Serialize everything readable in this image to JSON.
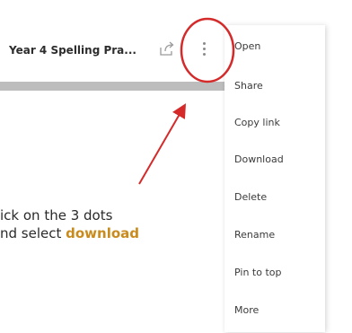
{
  "file": {
    "name": "Year 4 Spelling Pra..."
  },
  "icons": {
    "share": "share-icon",
    "more": "more-dots-icon"
  },
  "menu": {
    "items": [
      {
        "label": "Open"
      },
      {
        "label": "Share"
      },
      {
        "label": "Copy link"
      },
      {
        "label": "Download"
      },
      {
        "label": "Delete"
      },
      {
        "label": "Rename"
      },
      {
        "label": "Pin to top"
      },
      {
        "label": "More"
      }
    ]
  },
  "annotation": {
    "line1": "ick on the 3 dots",
    "line2_prefix": "nd select ",
    "line2_highlight": "download"
  },
  "colors": {
    "annotation_circle": "#d42a2a",
    "arrow": "#d42a2a",
    "highlight": "#c98b1d",
    "gray_bar": "#bdbdbd"
  }
}
